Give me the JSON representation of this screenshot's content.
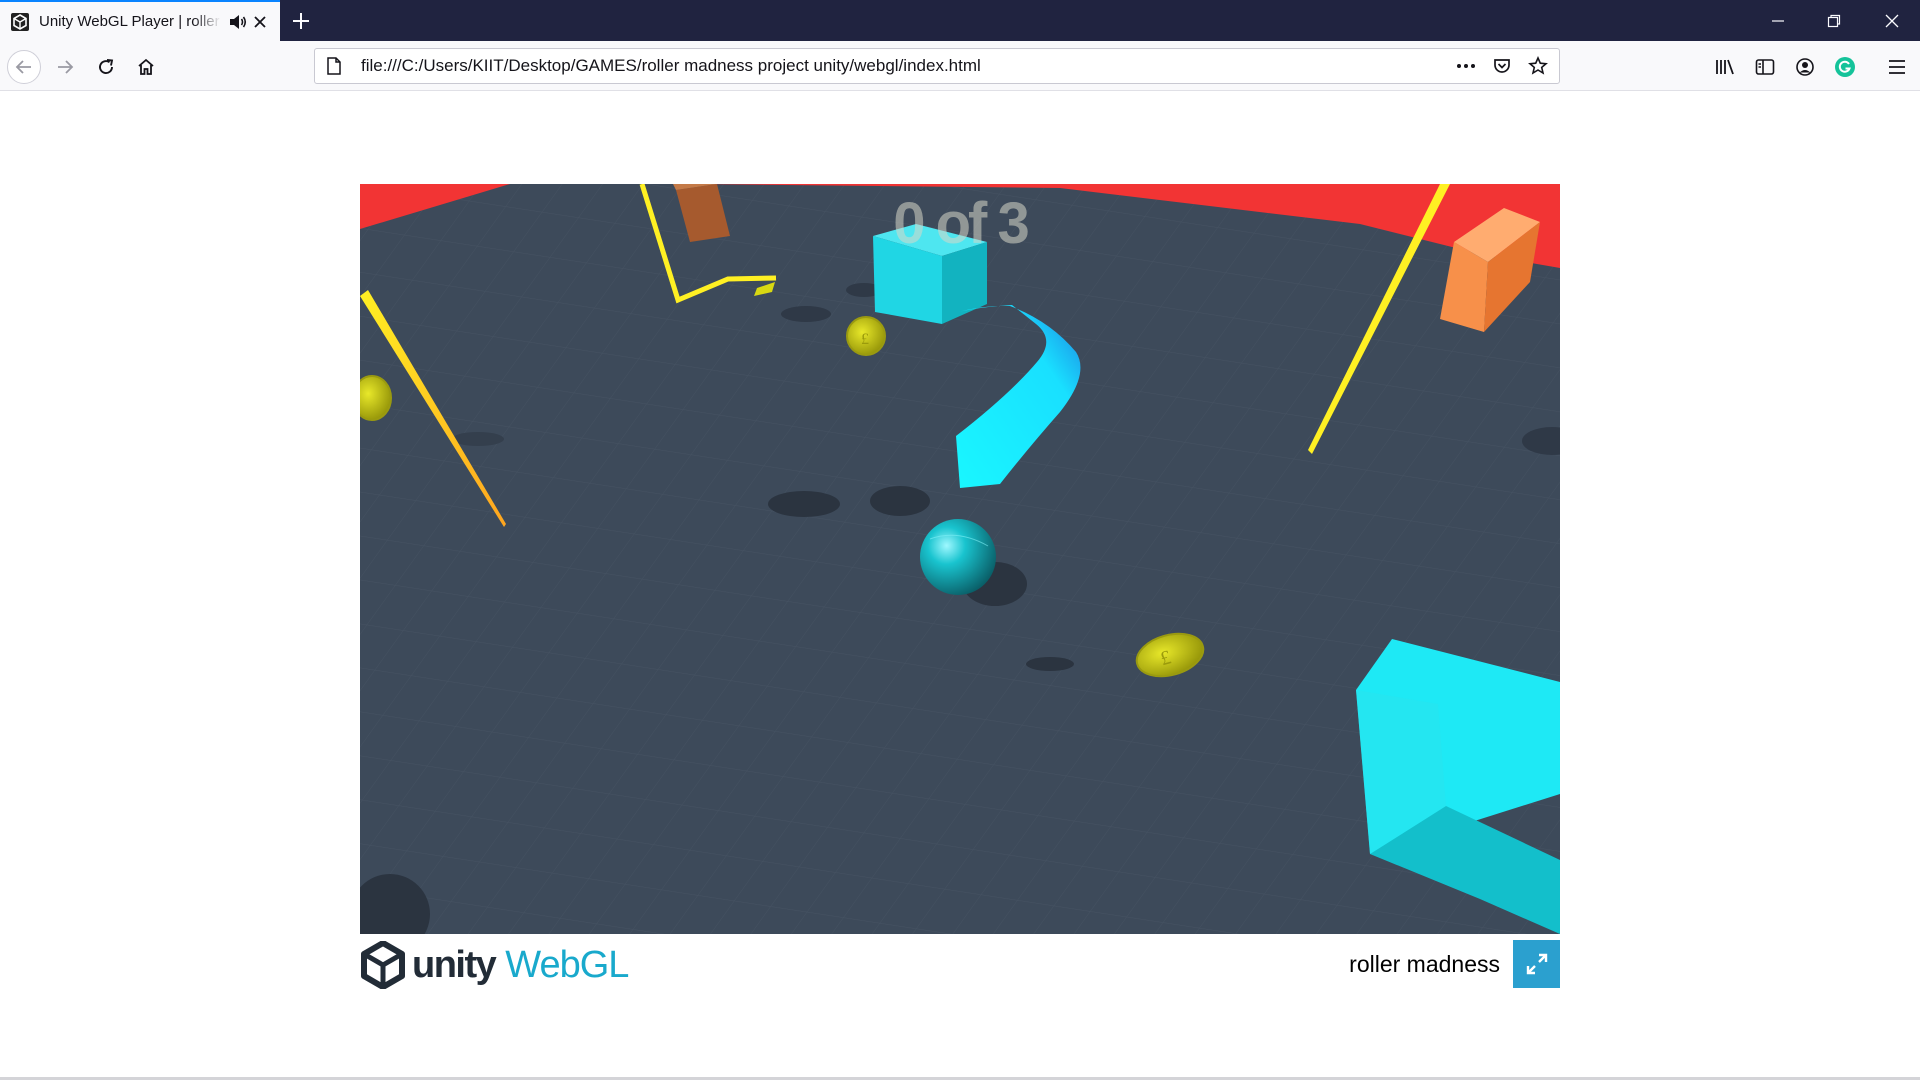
{
  "browser": {
    "tab": {
      "title": "Unity WebGL Player | roller madness",
      "favicon": "unity-icon",
      "audio_icon": "speaker-icon",
      "close_icon": "close-icon"
    },
    "new_tab_icon": "plus-icon",
    "window_controls": [
      "minimize-icon",
      "restore-icon",
      "close-icon"
    ],
    "nav": {
      "back_icon": "arrow-left-icon",
      "forward_icon": "arrow-right-icon",
      "reload_icon": "reload-icon",
      "home_icon": "home-icon"
    },
    "url": "file:///C:/Users/KIIT/Desktop/GAMES/roller madness project unity/webgl/index.html",
    "url_actions": [
      "more-icon",
      "pocket-icon",
      "bookmark-star-icon"
    ],
    "toolbar_icons": [
      "library-icon",
      "sidebar-icon",
      "account-icon",
      "grammarly-icon",
      "menu-icon"
    ]
  },
  "game": {
    "score_text": "0 of 3",
    "title": "roller madness",
    "logo_unity": "unity",
    "logo_webgl": "WebGL",
    "fullscreen_icon": "fullscreen-icon",
    "colors": {
      "floor": "#3d4a5a",
      "wall": "#f23434",
      "player": "#19c4cf",
      "trail": "#19f0ff",
      "coin": "#cccc11",
      "box_cyan": "#20d6e4",
      "box_orange": "#f7904a",
      "box_brown": "#a65a2e",
      "laser": "#ffee22",
      "accent": "#2ba0cf"
    }
  }
}
